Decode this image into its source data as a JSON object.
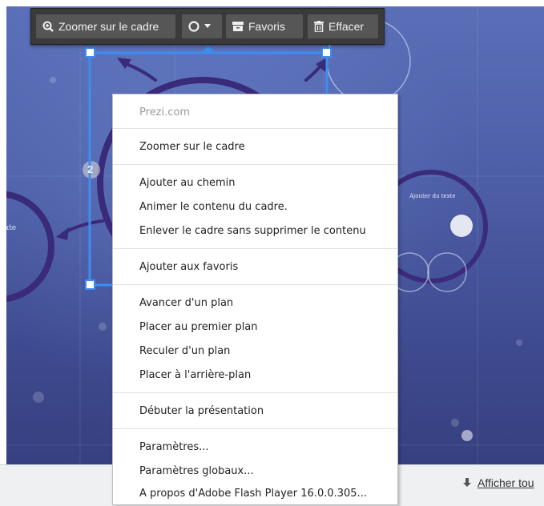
{
  "toolbar": {
    "zoom_label": "Zoomer sur le cadre",
    "favorites_label": "Favoris",
    "delete_label": "Effacer"
  },
  "canvas": {
    "text_left": "xte",
    "text_right_title": "Ajouter du texte",
    "frame_number": "2"
  },
  "context_menu": {
    "header": "Prezi.com",
    "groups": [
      [
        "Zoomer sur le cadre"
      ],
      [
        "Ajouter au chemin",
        "Animer le contenu du cadre.",
        "Enlever le cadre sans supprimer le contenu"
      ],
      [
        "Ajouter aux favoris"
      ],
      [
        "Avancer d'un plan",
        "Placer au premier plan",
        "Reculer d'un plan",
        "Placer à l'arrière-plan"
      ],
      [
        "Débuter la présentation"
      ],
      [
        "Paramètres...",
        "Paramètres globaux...",
        "A propos d'Adobe Flash Player 16.0.0.305..."
      ]
    ]
  },
  "footer": {
    "show_all_label": "Afficher tou"
  },
  "colors": {
    "toolbar_bg": "#3a3a3a",
    "selection_blue": "#3d8ef0",
    "canvas_dark": "#3e4a8f"
  },
  "icons": [
    "zoom-icon",
    "circle-icon",
    "chevron-down-icon",
    "archive-icon",
    "trash-icon",
    "download-icon"
  ]
}
